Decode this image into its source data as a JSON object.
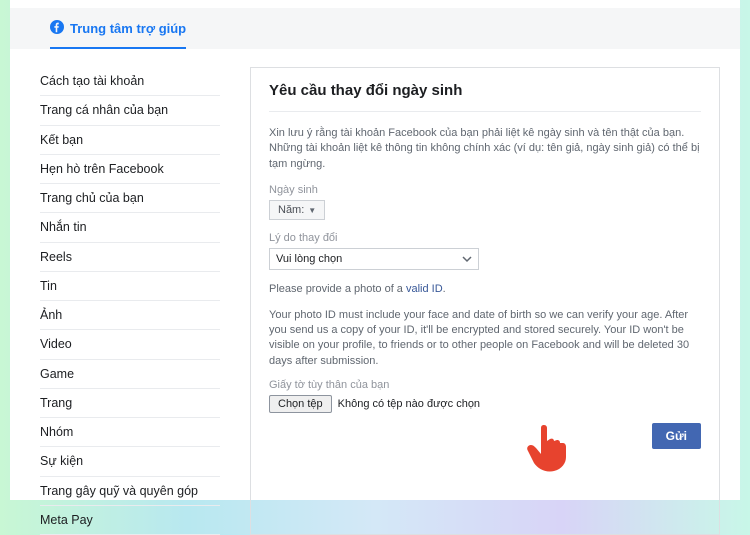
{
  "topbar": {
    "help_center": "Trung tâm trợ giúp"
  },
  "sidebar": {
    "items": [
      "Cách tạo tài khoản",
      "Trang cá nhân của bạn",
      "Kết bạn",
      "Hẹn hò trên Facebook",
      "Trang chủ của bạn",
      "Nhắn tin",
      "Reels",
      "Tin",
      "Ảnh",
      "Video",
      "Game",
      "Trang",
      "Nhóm",
      "Sự kiện",
      "Trang gây quỹ và quyên góp",
      "Meta Pay"
    ]
  },
  "content": {
    "title": "Yêu cầu thay đổi ngày sinh",
    "notice": "Xin lưu ý rằng tài khoản Facebook của bạn phải liệt kê ngày sinh và tên thật của bạn. Những tài khoản liệt kê thông tin không chính xác (ví dụ: tên giả, ngày sinh giả) có thể bị tạm ngừng.",
    "birthday_label": "Ngày sinh",
    "year_select": "Năm:",
    "reason_label": "Lý do thay đổi",
    "reason_placeholder": "Vui lòng chọn",
    "photo_prompt_prefix": "Please provide a photo of a ",
    "photo_prompt_link": "valid ID",
    "photo_prompt_suffix": ".",
    "photo_instructions": "Your photo ID must include your face and date of birth so we can verify your age. After you send us a copy of your ID, it'll be encrypted and stored securely. Your ID won't be visible on your profile, to friends or to other people on Facebook and will be deleted 30 days after submission.",
    "id_label": "Giấy tờ tùy thân của bạn",
    "file_button": "Chọn tệp",
    "file_none": "Không có tệp nào được chọn",
    "submit": "Gửi"
  }
}
